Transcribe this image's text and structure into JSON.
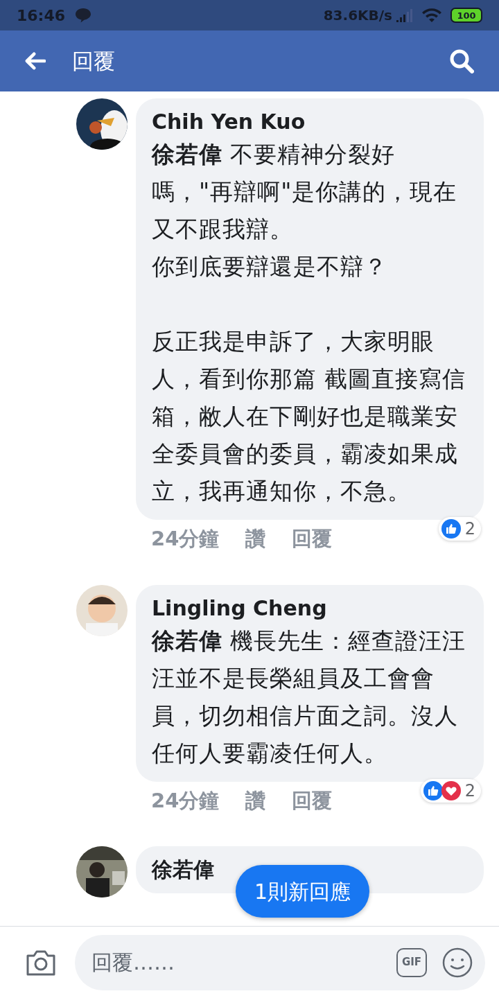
{
  "status_bar": {
    "time": "16:46",
    "speed": "83.6KB/s",
    "battery": "100"
  },
  "header": {
    "title": "回覆"
  },
  "comments": [
    {
      "author": "Chih Yen Kuo",
      "avatar": {
        "kind": "picture"
      },
      "paragraphs": [
        {
          "lines": [
            "**徐若偉** 不要精神分裂好嗎，\"再辯啊\"是你講的，現在又不跟我辯。",
            "你到底要辯還是不辯？"
          ]
        },
        {
          "lines": [
            "反正我是申訴了，大家明眼人，看到你那篇 截圖直接寫信箱，敝人在下剛好也是職業安全委員會的委員，霸凌如果成立，我再通知你，不急。"
          ]
        }
      ],
      "time": "24分鐘",
      "like": "讚",
      "reply": "回覆",
      "reactions": {
        "icons": [
          {
            "kind": "like"
          }
        ],
        "count": "2"
      }
    },
    {
      "author": "Lingling Cheng",
      "avatar": {
        "kind": "picture"
      },
      "paragraphs": [
        {
          "lines": [
            "**徐若偉** 機長先生：經查證汪汪汪並不是長榮組員及工會會員，切勿相信片面之詞。沒人任何人要霸凌任何人。"
          ]
        }
      ],
      "time": "24分鐘",
      "like": "讚",
      "reply": "回覆",
      "reactions": {
        "icons": [
          {
            "kind": "like"
          },
          {
            "kind": "love"
          }
        ],
        "count": "2"
      }
    },
    {
      "author": "徐若偉",
      "avatar": {
        "kind": "picture"
      }
    }
  ],
  "new_replies_pill": "1則新回應",
  "composer": {
    "placeholder": "回覆……",
    "gif": "GIF"
  }
}
